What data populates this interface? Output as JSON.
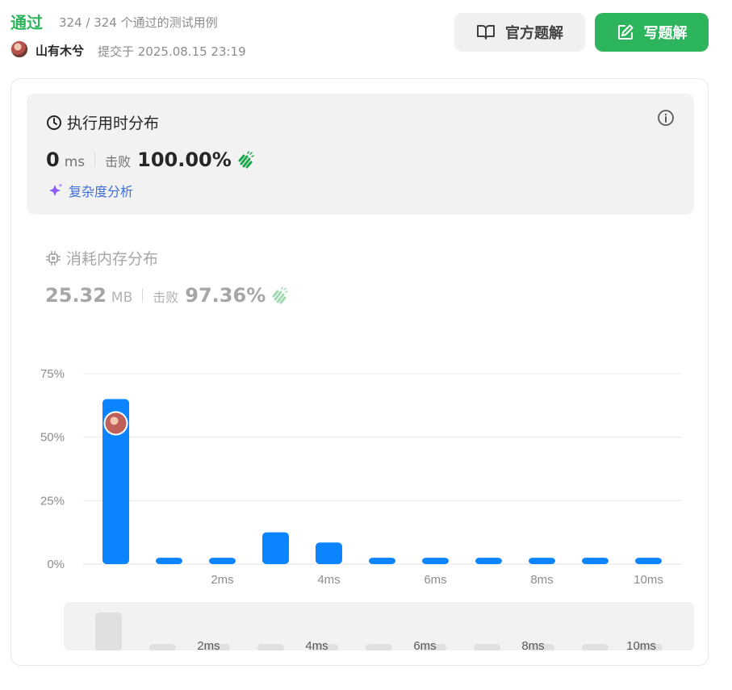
{
  "header": {
    "status": "通过",
    "cases": "324 / 324 个通过的测试用例",
    "username": "山有木兮",
    "submitted": "提交于 2025.08.15 23:19",
    "official_solution": "官方题解",
    "write_solution": "写题解"
  },
  "runtime": {
    "title": "执行用时分布",
    "value": "0",
    "unit": "ms",
    "beat_label": "击败",
    "beat_value": "100.00%",
    "complexity": "复杂度分析"
  },
  "memory": {
    "title": "消耗内存分布",
    "value": "25.32",
    "unit": "MB",
    "beat_label": "击败",
    "beat_value": "97.36%"
  },
  "colors": {
    "accent_green": "#2db55d",
    "bar_blue": "#0a84ff",
    "link_blue": "#3b6fd8"
  },
  "chart_data": {
    "type": "bar",
    "y_ticks": [
      "75%",
      "50%",
      "25%",
      "0%"
    ],
    "x_ticks": [
      "2ms",
      "4ms",
      "6ms",
      "8ms",
      "10ms"
    ],
    "ylim": [
      0,
      75
    ],
    "categories": [
      "0ms",
      "1ms",
      "2ms",
      "3ms",
      "4ms",
      "5ms",
      "6ms",
      "7ms",
      "8ms",
      "9ms",
      "10ms"
    ],
    "values": [
      65,
      2.5,
      2.5,
      12.5,
      8.5,
      2.5,
      2.5,
      2.5,
      2.5,
      2.5,
      2.5
    ],
    "highlight_index": 0,
    "mini_values": [
      65,
      2.5,
      2.5,
      2.5,
      2.5,
      2.5,
      2.5,
      2.5,
      2.5,
      2.5,
      2.5
    ],
    "mini_x_ticks": [
      "2ms",
      "4ms",
      "6ms",
      "8ms",
      "10ms"
    ]
  }
}
